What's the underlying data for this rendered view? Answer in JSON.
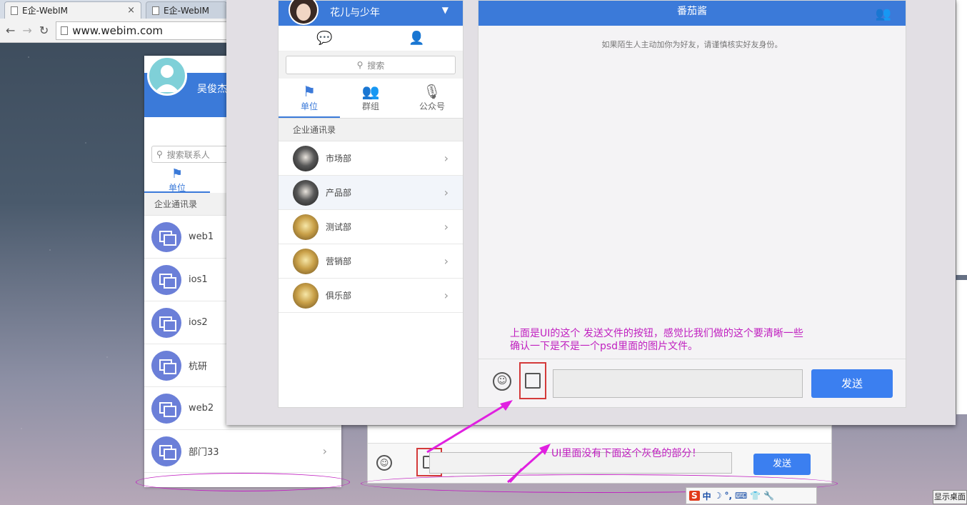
{
  "browser": {
    "tabs": [
      {
        "title": "E企-WebIM",
        "close": "×"
      },
      {
        "title": "E企-WebIM"
      }
    ],
    "nav": {
      "back": "←",
      "forward": "→",
      "reload": "↻"
    },
    "url": "www.webim.com"
  },
  "back_panel": {
    "user_name": "吴俊杰",
    "search_placeholder": "搜索联系人",
    "category": "单位",
    "section_title": "企业通讯录",
    "groups": [
      "web1",
      "ios1",
      "ios2",
      "杭研",
      "web2",
      "部门33"
    ]
  },
  "contacts": {
    "user_name": "花儿与少年",
    "search_placeholder": "搜索",
    "categories": [
      "单位",
      "群组",
      "公众号"
    ],
    "section_title": "企业通讯录",
    "departments": [
      "市场部",
      "产品部",
      "测试部",
      "营销部",
      "俱乐部"
    ]
  },
  "chat": {
    "title": "番茄酱",
    "notice": "如果陌生人主动加你为好友，请谨慎核实好友身份。",
    "send_label": "发送"
  },
  "lower_chat": {
    "send_label": "发送"
  },
  "annotations": {
    "top_line1": "上面是UI的这个 发送文件的按钮，感觉比我们做的这个要清晰一些",
    "top_line2": "确认一下是不是一个psd里面的图片文件。",
    "bottom": "UI里面没有下面这个灰色的部分！"
  },
  "tray": {
    "ime": "S",
    "lang": "中"
  },
  "taskbar": {
    "show_desktop": "显示桌面"
  },
  "colors": {
    "accent": "#3b7ad9",
    "send": "#3b7ff0",
    "annotation": "#c020c0",
    "highlight_box": "#d43a3a"
  }
}
